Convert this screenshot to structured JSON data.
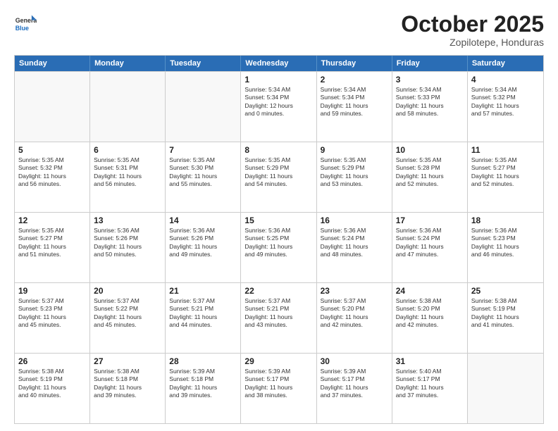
{
  "header": {
    "logo_general": "General",
    "logo_blue": "Blue",
    "month": "October 2025",
    "location": "Zopilotepe, Honduras"
  },
  "weekdays": [
    "Sunday",
    "Monday",
    "Tuesday",
    "Wednesday",
    "Thursday",
    "Friday",
    "Saturday"
  ],
  "weeks": [
    [
      {
        "day": "",
        "lines": []
      },
      {
        "day": "",
        "lines": []
      },
      {
        "day": "",
        "lines": []
      },
      {
        "day": "1",
        "lines": [
          "Sunrise: 5:34 AM",
          "Sunset: 5:34 PM",
          "Daylight: 12 hours",
          "and 0 minutes."
        ]
      },
      {
        "day": "2",
        "lines": [
          "Sunrise: 5:34 AM",
          "Sunset: 5:34 PM",
          "Daylight: 11 hours",
          "and 59 minutes."
        ]
      },
      {
        "day": "3",
        "lines": [
          "Sunrise: 5:34 AM",
          "Sunset: 5:33 PM",
          "Daylight: 11 hours",
          "and 58 minutes."
        ]
      },
      {
        "day": "4",
        "lines": [
          "Sunrise: 5:34 AM",
          "Sunset: 5:32 PM",
          "Daylight: 11 hours",
          "and 57 minutes."
        ]
      }
    ],
    [
      {
        "day": "5",
        "lines": [
          "Sunrise: 5:35 AM",
          "Sunset: 5:32 PM",
          "Daylight: 11 hours",
          "and 56 minutes."
        ]
      },
      {
        "day": "6",
        "lines": [
          "Sunrise: 5:35 AM",
          "Sunset: 5:31 PM",
          "Daylight: 11 hours",
          "and 56 minutes."
        ]
      },
      {
        "day": "7",
        "lines": [
          "Sunrise: 5:35 AM",
          "Sunset: 5:30 PM",
          "Daylight: 11 hours",
          "and 55 minutes."
        ]
      },
      {
        "day": "8",
        "lines": [
          "Sunrise: 5:35 AM",
          "Sunset: 5:29 PM",
          "Daylight: 11 hours",
          "and 54 minutes."
        ]
      },
      {
        "day": "9",
        "lines": [
          "Sunrise: 5:35 AM",
          "Sunset: 5:29 PM",
          "Daylight: 11 hours",
          "and 53 minutes."
        ]
      },
      {
        "day": "10",
        "lines": [
          "Sunrise: 5:35 AM",
          "Sunset: 5:28 PM",
          "Daylight: 11 hours",
          "and 52 minutes."
        ]
      },
      {
        "day": "11",
        "lines": [
          "Sunrise: 5:35 AM",
          "Sunset: 5:27 PM",
          "Daylight: 11 hours",
          "and 52 minutes."
        ]
      }
    ],
    [
      {
        "day": "12",
        "lines": [
          "Sunrise: 5:35 AM",
          "Sunset: 5:27 PM",
          "Daylight: 11 hours",
          "and 51 minutes."
        ]
      },
      {
        "day": "13",
        "lines": [
          "Sunrise: 5:36 AM",
          "Sunset: 5:26 PM",
          "Daylight: 11 hours",
          "and 50 minutes."
        ]
      },
      {
        "day": "14",
        "lines": [
          "Sunrise: 5:36 AM",
          "Sunset: 5:26 PM",
          "Daylight: 11 hours",
          "and 49 minutes."
        ]
      },
      {
        "day": "15",
        "lines": [
          "Sunrise: 5:36 AM",
          "Sunset: 5:25 PM",
          "Daylight: 11 hours",
          "and 49 minutes."
        ]
      },
      {
        "day": "16",
        "lines": [
          "Sunrise: 5:36 AM",
          "Sunset: 5:24 PM",
          "Daylight: 11 hours",
          "and 48 minutes."
        ]
      },
      {
        "day": "17",
        "lines": [
          "Sunrise: 5:36 AM",
          "Sunset: 5:24 PM",
          "Daylight: 11 hours",
          "and 47 minutes."
        ]
      },
      {
        "day": "18",
        "lines": [
          "Sunrise: 5:36 AM",
          "Sunset: 5:23 PM",
          "Daylight: 11 hours",
          "and 46 minutes."
        ]
      }
    ],
    [
      {
        "day": "19",
        "lines": [
          "Sunrise: 5:37 AM",
          "Sunset: 5:23 PM",
          "Daylight: 11 hours",
          "and 45 minutes."
        ]
      },
      {
        "day": "20",
        "lines": [
          "Sunrise: 5:37 AM",
          "Sunset: 5:22 PM",
          "Daylight: 11 hours",
          "and 45 minutes."
        ]
      },
      {
        "day": "21",
        "lines": [
          "Sunrise: 5:37 AM",
          "Sunset: 5:21 PM",
          "Daylight: 11 hours",
          "and 44 minutes."
        ]
      },
      {
        "day": "22",
        "lines": [
          "Sunrise: 5:37 AM",
          "Sunset: 5:21 PM",
          "Daylight: 11 hours",
          "and 43 minutes."
        ]
      },
      {
        "day": "23",
        "lines": [
          "Sunrise: 5:37 AM",
          "Sunset: 5:20 PM",
          "Daylight: 11 hours",
          "and 42 minutes."
        ]
      },
      {
        "day": "24",
        "lines": [
          "Sunrise: 5:38 AM",
          "Sunset: 5:20 PM",
          "Daylight: 11 hours",
          "and 42 minutes."
        ]
      },
      {
        "day": "25",
        "lines": [
          "Sunrise: 5:38 AM",
          "Sunset: 5:19 PM",
          "Daylight: 11 hours",
          "and 41 minutes."
        ]
      }
    ],
    [
      {
        "day": "26",
        "lines": [
          "Sunrise: 5:38 AM",
          "Sunset: 5:19 PM",
          "Daylight: 11 hours",
          "and 40 minutes."
        ]
      },
      {
        "day": "27",
        "lines": [
          "Sunrise: 5:38 AM",
          "Sunset: 5:18 PM",
          "Daylight: 11 hours",
          "and 39 minutes."
        ]
      },
      {
        "day": "28",
        "lines": [
          "Sunrise: 5:39 AM",
          "Sunset: 5:18 PM",
          "Daylight: 11 hours",
          "and 39 minutes."
        ]
      },
      {
        "day": "29",
        "lines": [
          "Sunrise: 5:39 AM",
          "Sunset: 5:17 PM",
          "Daylight: 11 hours",
          "and 38 minutes."
        ]
      },
      {
        "day": "30",
        "lines": [
          "Sunrise: 5:39 AM",
          "Sunset: 5:17 PM",
          "Daylight: 11 hours",
          "and 37 minutes."
        ]
      },
      {
        "day": "31",
        "lines": [
          "Sunrise: 5:40 AM",
          "Sunset: 5:17 PM",
          "Daylight: 11 hours",
          "and 37 minutes."
        ]
      },
      {
        "day": "",
        "lines": []
      }
    ]
  ]
}
